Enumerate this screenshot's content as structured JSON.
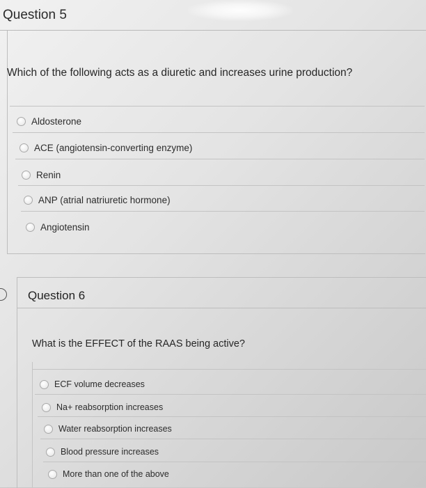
{
  "question5": {
    "title": "Question 5",
    "prompt": "Which of the following acts as a diuretic and increases urine production?",
    "options": [
      "Aldosterone",
      "ACE (angiotensin-converting enzyme)",
      "Renin",
      "ANP (atrial natriuretic hormone)",
      "Angiotensin"
    ]
  },
  "question6": {
    "title": "Question 6",
    "prompt": "What is the EFFECT of the RAAS being active?",
    "options": [
      "ECF volume decreases",
      "Na+ reabsorption increases",
      "Water reabsorption increases",
      "Blood pressure increases",
      "More than one of the above"
    ]
  }
}
